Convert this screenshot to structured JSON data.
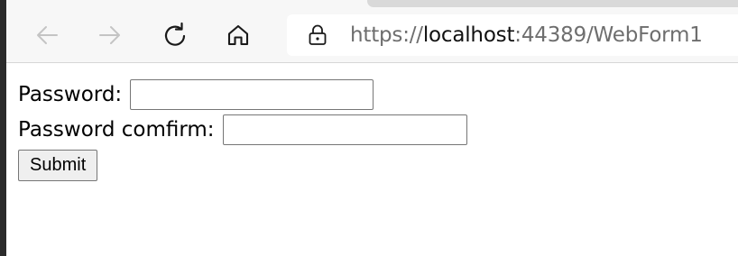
{
  "browser": {
    "nav": {
      "back_icon": "arrow-left-icon",
      "forward_icon": "arrow-right-icon",
      "refresh_icon": "refresh-icon",
      "home_icon": "home-icon"
    },
    "address": {
      "lock_icon": "lock-icon",
      "scheme": "https://",
      "host": "localhost",
      "rest": ":44389/WebForm1"
    }
  },
  "form": {
    "password_label": "Password:",
    "password_value": "",
    "confirm_label": "Password comfirm:",
    "confirm_value": "",
    "submit_label": "Submit"
  },
  "colors": {
    "chrome_bg": "#f7f7f7",
    "disabled_icon": "#c4c4c4",
    "active_icon": "#1a1a1a",
    "url_muted": "#6e6e6e"
  }
}
